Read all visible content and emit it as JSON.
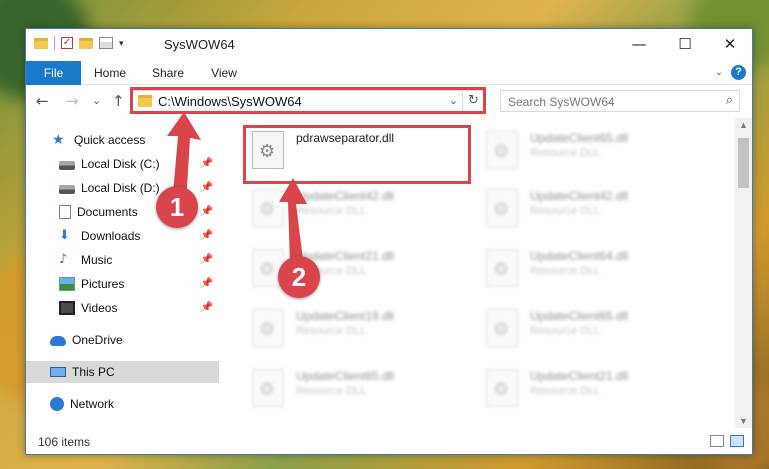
{
  "window": {
    "title": "SysWOW64",
    "minimize": "—",
    "maximize": "☐",
    "close": "✕"
  },
  "ribbon": {
    "tabs": [
      "File",
      "Home",
      "Share",
      "View"
    ],
    "help": "?"
  },
  "nav": {
    "back": "←",
    "forward": "→",
    "recent": "⌄",
    "up": "↑",
    "address": "C:\\Windows\\SysWOW64",
    "refresh": "↻",
    "search_placeholder": "Search SysWOW64"
  },
  "sidebar": {
    "items": [
      {
        "label": "Quick access",
        "icon": "star-icon"
      },
      {
        "label": "Local Disk (C:)",
        "icon": "drive-icon",
        "pinned": true
      },
      {
        "label": "Local Disk (D:)",
        "icon": "drive-icon",
        "pinned": true
      },
      {
        "label": "Documents",
        "icon": "documents-icon",
        "pinned": true
      },
      {
        "label": "Downloads",
        "icon": "download-icon",
        "pinned": true
      },
      {
        "label": "Music",
        "icon": "music-icon",
        "pinned": true
      },
      {
        "label": "Pictures",
        "icon": "pictures-icon",
        "pinned": true
      },
      {
        "label": "Videos",
        "icon": "videos-icon",
        "pinned": true
      },
      {
        "label": "OneDrive",
        "icon": "onedrive-icon"
      },
      {
        "label": "This PC",
        "icon": "pc-icon",
        "selected": true
      },
      {
        "label": "Network",
        "icon": "network-icon"
      }
    ]
  },
  "files": {
    "highlighted": {
      "name": "pdrawseparator.dll"
    },
    "others": [
      {
        "name": "UpdateClient65.dll",
        "type": "Resource DLL"
      },
      {
        "name": "UpdateClient42.dll",
        "type": "Resource DLL"
      },
      {
        "name": "UpdateClient42.dll",
        "type": "Resource DLL"
      },
      {
        "name": "UpdateClient21.dll",
        "type": "Resource DLL"
      },
      {
        "name": "UpdateClient64.dll",
        "type": "Resource DLL"
      },
      {
        "name": "UpdateClient19.dll",
        "type": "Resource DLL"
      },
      {
        "name": "UpdateClient65.dll",
        "type": "Resource DLL"
      },
      {
        "name": "UpdateClient65.dll",
        "type": "Resource DLL"
      },
      {
        "name": "UpdateClient21.dll",
        "type": "Resource DLL"
      }
    ]
  },
  "status": {
    "item_count": "106 items"
  },
  "annotations": {
    "badge1": "1",
    "badge2": "2",
    "color": "#d9454a"
  }
}
